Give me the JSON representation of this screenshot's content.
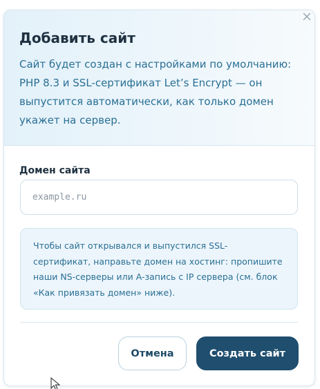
{
  "modal": {
    "title": "Добавить сайт",
    "description": "Сайт будет создан с настройками по умолчанию: PHP 8.3 и SSL-сертификат Let’s Encrypt — он выпустится автоматически, как только домен укажет на сервер.",
    "close_icon": "close-icon"
  },
  "form": {
    "domain_label": "Домен сайта",
    "domain_placeholder": "example.ru",
    "domain_value": ""
  },
  "info": {
    "text": "Чтобы сайт открывался и выпустился SSL-сертификат, направьте домен на хостинг: пропишите наши NS-серверы или A-запись с IP сервера (см. блок «Как привязать домен» ниже)."
  },
  "actions": {
    "cancel_label": "Отмена",
    "create_label": "Создать сайт"
  },
  "colors": {
    "accent": "#1f4e6e",
    "text_blue": "#2a6f94",
    "title": "#1f3140"
  }
}
